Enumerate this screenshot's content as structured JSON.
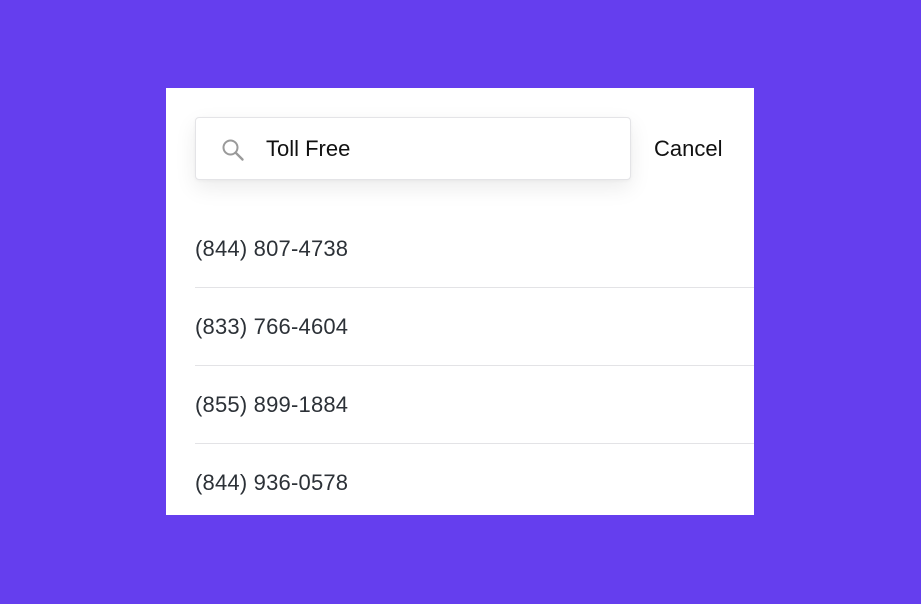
{
  "search": {
    "value": "Toll Free",
    "icon": "search-icon",
    "cancel_label": "Cancel"
  },
  "results": [
    "(844) 807-4738",
    "(833) 766-4604",
    "(855) 899-1884",
    "(844) 936-0578"
  ],
  "colors": {
    "background": "#653EEE",
    "panel": "#FFFFFF",
    "text": "#2C3137",
    "divider": "#E3E3E6",
    "icon": "#9A9A9A"
  }
}
